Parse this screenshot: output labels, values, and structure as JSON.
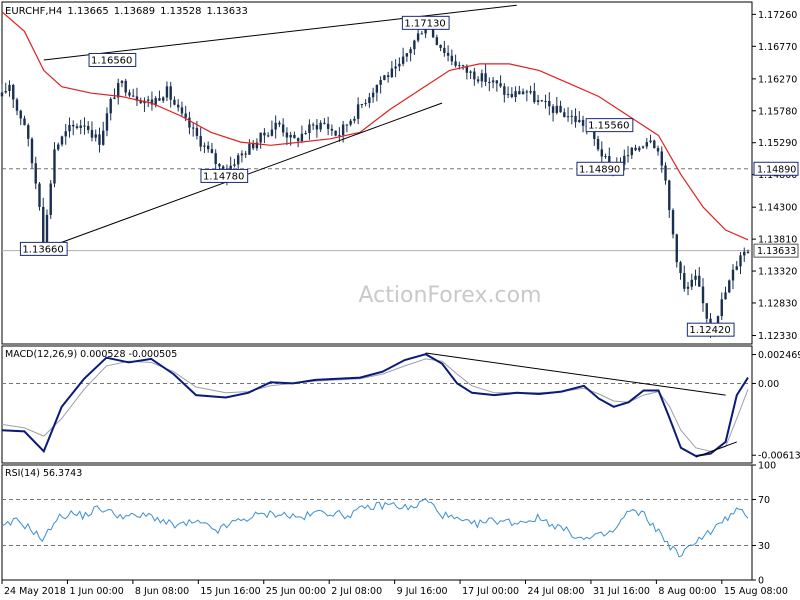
{
  "chart_data": [
    {
      "type": "candlestick",
      "title": "EURCHF,H4",
      "ohlc_readout": [
        "1.13665",
        "1.13689",
        "1.13528",
        "1.13633"
      ],
      "y_ticks": [
        "1.17260",
        "1.16770",
        "1.16270",
        "1.15780",
        "1.15290",
        "1.14800",
        "1.14300",
        "1.13810",
        "1.13320",
        "1.12830",
        "1.12330"
      ],
      "ylim": [
        1.122,
        1.1745
      ],
      "current_price": "1.13633",
      "current_price_value": 1.13633,
      "resistance_label": "1.14890",
      "resistance_value": 1.1489,
      "annotations": [
        {
          "text": "1.16560",
          "value": 1.1656,
          "x_frac": 0.148,
          "side": "left"
        },
        {
          "text": "1.14780",
          "value": 1.1478,
          "x_frac": 0.298,
          "side": "left"
        },
        {
          "text": "1.17130",
          "value": 1.1713,
          "x_frac": 0.568,
          "side": "left"
        },
        {
          "text": "1.15560",
          "value": 1.1556,
          "x_frac": 0.783,
          "side": "right"
        },
        {
          "text": "1.14890",
          "value": 1.1489,
          "x_frac": 0.802,
          "side": "left"
        },
        {
          "text": "1.12420",
          "value": 1.1242,
          "x_frac": 0.95,
          "side": "left"
        },
        {
          "text": "1.13660",
          "value": 1.1366,
          "x_frac": 0.056,
          "side": "left"
        }
      ],
      "close_path": [
        [
          0.0,
          1.16
        ],
        [
          0.01,
          1.162
        ],
        [
          0.02,
          1.158
        ],
        [
          0.03,
          1.156
        ],
        [
          0.04,
          1.15
        ],
        [
          0.05,
          1.144
        ],
        [
          0.056,
          1.137
        ],
        [
          0.07,
          1.152
        ],
        [
          0.09,
          1.155
        ],
        [
          0.11,
          1.156
        ],
        [
          0.13,
          1.153
        ],
        [
          0.148,
          1.16
        ],
        [
          0.16,
          1.162
        ],
        [
          0.18,
          1.16
        ],
        [
          0.2,
          1.159
        ],
        [
          0.22,
          1.161
        ],
        [
          0.24,
          1.157
        ],
        [
          0.26,
          1.154
        ],
        [
          0.28,
          1.151
        ],
        [
          0.298,
          1.148
        ],
        [
          0.31,
          1.15
        ],
        [
          0.33,
          1.152
        ],
        [
          0.35,
          1.154
        ],
        [
          0.37,
          1.156
        ],
        [
          0.39,
          1.153
        ],
        [
          0.41,
          1.155
        ],
        [
          0.43,
          1.156
        ],
        [
          0.45,
          1.154
        ],
        [
          0.47,
          1.157
        ],
        [
          0.49,
          1.16
        ],
        [
          0.51,
          1.163
        ],
        [
          0.53,
          1.164
        ],
        [
          0.55,
          1.168
        ],
        [
          0.568,
          1.1713
        ],
        [
          0.58,
          1.169
        ],
        [
          0.6,
          1.166
        ],
        [
          0.62,
          1.164
        ],
        [
          0.64,
          1.163
        ],
        [
          0.66,
          1.162
        ],
        [
          0.68,
          1.16
        ],
        [
          0.7,
          1.161
        ],
        [
          0.72,
          1.159
        ],
        [
          0.74,
          1.158
        ],
        [
          0.76,
          1.157
        ],
        [
          0.783,
          1.1556
        ],
        [
          0.8,
          1.152
        ],
        [
          0.815,
          1.1489
        ],
        [
          0.83,
          1.15
        ],
        [
          0.85,
          1.152
        ],
        [
          0.87,
          1.154
        ],
        [
          0.885,
          1.15
        ],
        [
          0.895,
          1.142
        ],
        [
          0.905,
          1.135
        ],
        [
          0.915,
          1.13
        ],
        [
          0.93,
          1.132
        ],
        [
          0.94,
          1.128
        ],
        [
          0.95,
          1.1245
        ],
        [
          0.96,
          1.127
        ],
        [
          0.97,
          1.13
        ],
        [
          0.98,
          1.133
        ],
        [
          0.99,
          1.136
        ],
        [
          1.0,
          1.1363
        ]
      ],
      "ma_path": [
        [
          0.0,
          1.173
        ],
        [
          0.03,
          1.17
        ],
        [
          0.056,
          1.164
        ],
        [
          0.08,
          1.1615
        ],
        [
          0.12,
          1.1605
        ],
        [
          0.16,
          1.16
        ],
        [
          0.2,
          1.159
        ],
        [
          0.24,
          1.157
        ],
        [
          0.28,
          1.1545
        ],
        [
          0.32,
          1.153
        ],
        [
          0.36,
          1.1525
        ],
        [
          0.4,
          1.153
        ],
        [
          0.44,
          1.1535
        ],
        [
          0.48,
          1.1545
        ],
        [
          0.52,
          1.158
        ],
        [
          0.56,
          1.161
        ],
        [
          0.6,
          1.164
        ],
        [
          0.64,
          1.165
        ],
        [
          0.68,
          1.165
        ],
        [
          0.72,
          1.164
        ],
        [
          0.76,
          1.162
        ],
        [
          0.8,
          1.16
        ],
        [
          0.84,
          1.157
        ],
        [
          0.88,
          1.154
        ],
        [
          0.91,
          1.148
        ],
        [
          0.94,
          1.143
        ],
        [
          0.97,
          1.1395
        ],
        [
          1.0,
          1.138
        ]
      ],
      "trendlines": [
        {
          "from": [
            0.056,
            1.1656
          ],
          "to": [
            0.69,
            1.174
          ]
        },
        {
          "from": [
            0.056,
            1.1366
          ],
          "to": [
            0.59,
            1.159
          ]
        }
      ]
    },
    {
      "type": "line",
      "title": "MACD(12,26,9) 0.000528 -0.000505",
      "y_ticks": [
        "0.002469",
        "0.00",
        "-0.006136"
      ],
      "ylim": [
        -0.0068,
        0.0032
      ],
      "zero_line": 0,
      "macd_path": [
        [
          0.0,
          -0.004
        ],
        [
          0.03,
          -0.0041
        ],
        [
          0.056,
          -0.0058
        ],
        [
          0.08,
          -0.002
        ],
        [
          0.11,
          0.0004
        ],
        [
          0.14,
          0.0022
        ],
        [
          0.17,
          0.0018
        ],
        [
          0.2,
          0.0021
        ],
        [
          0.23,
          0.0008
        ],
        [
          0.26,
          -0.001
        ],
        [
          0.3,
          -0.0012
        ],
        [
          0.33,
          -0.0008
        ],
        [
          0.36,
          0.0001
        ],
        [
          0.39,
          0.0
        ],
        [
          0.42,
          0.0003
        ],
        [
          0.45,
          0.0004
        ],
        [
          0.48,
          0.0005
        ],
        [
          0.51,
          0.001
        ],
        [
          0.54,
          0.002
        ],
        [
          0.568,
          0.0025
        ],
        [
          0.59,
          0.0017
        ],
        [
          0.61,
          0.0
        ],
        [
          0.63,
          -0.0008
        ],
        [
          0.66,
          -0.001
        ],
        [
          0.69,
          -0.0008
        ],
        [
          0.72,
          -0.0009
        ],
        [
          0.75,
          -0.0007
        ],
        [
          0.78,
          -0.0002
        ],
        [
          0.8,
          -0.0013
        ],
        [
          0.82,
          -0.002
        ],
        [
          0.84,
          -0.0016
        ],
        [
          0.86,
          -0.0006
        ],
        [
          0.88,
          -0.0006
        ],
        [
          0.895,
          -0.003
        ],
        [
          0.91,
          -0.0055
        ],
        [
          0.93,
          -0.0062
        ],
        [
          0.95,
          -0.006
        ],
        [
          0.97,
          -0.005
        ],
        [
          0.985,
          -0.001
        ],
        [
          1.0,
          0.0005
        ]
      ],
      "signal_path": [
        [
          0.0,
          -0.0035
        ],
        [
          0.03,
          -0.0038
        ],
        [
          0.056,
          -0.0045
        ],
        [
          0.08,
          -0.003
        ],
        [
          0.11,
          -0.0005
        ],
        [
          0.14,
          0.0015
        ],
        [
          0.17,
          0.0019
        ],
        [
          0.2,
          0.0018
        ],
        [
          0.23,
          0.001
        ],
        [
          0.26,
          -0.0003
        ],
        [
          0.3,
          -0.0008
        ],
        [
          0.33,
          -0.0007
        ],
        [
          0.36,
          -0.0002
        ],
        [
          0.39,
          0.0
        ],
        [
          0.42,
          0.0002
        ],
        [
          0.45,
          0.0003
        ],
        [
          0.48,
          0.0004
        ],
        [
          0.51,
          0.0008
        ],
        [
          0.54,
          0.0015
        ],
        [
          0.568,
          0.0021
        ],
        [
          0.59,
          0.0019
        ],
        [
          0.61,
          0.0008
        ],
        [
          0.63,
          -0.0002
        ],
        [
          0.66,
          -0.0008
        ],
        [
          0.69,
          -0.0008
        ],
        [
          0.72,
          -0.0008
        ],
        [
          0.75,
          -0.0007
        ],
        [
          0.78,
          -0.0004
        ],
        [
          0.8,
          -0.0009
        ],
        [
          0.82,
          -0.0015
        ],
        [
          0.84,
          -0.0016
        ],
        [
          0.86,
          -0.001
        ],
        [
          0.88,
          -0.0007
        ],
        [
          0.895,
          -0.002
        ],
        [
          0.91,
          -0.004
        ],
        [
          0.93,
          -0.0055
        ],
        [
          0.95,
          -0.0058
        ],
        [
          0.97,
          -0.0054
        ],
        [
          0.985,
          -0.003
        ],
        [
          1.0,
          -0.0005
        ]
      ],
      "trendlines": [
        {
          "from": [
            0.568,
            0.0026
          ],
          "to": [
            0.97,
            -0.001
          ]
        },
        {
          "from": [
            0.93,
            -0.0063
          ],
          "to": [
            0.985,
            -0.005
          ]
        }
      ]
    },
    {
      "type": "line",
      "title": "RSI(14) 56.3743",
      "y_ticks": [
        "100",
        "70",
        "30",
        "0"
      ],
      "ylim": [
        0,
        100
      ],
      "levels": [
        70,
        30
      ],
      "rsi_path": [
        [
          0.0,
          45
        ],
        [
          0.02,
          52
        ],
        [
          0.04,
          44
        ],
        [
          0.056,
          34
        ],
        [
          0.07,
          52
        ],
        [
          0.09,
          58
        ],
        [
          0.11,
          56
        ],
        [
          0.13,
          63
        ],
        [
          0.148,
          58
        ],
        [
          0.17,
          55
        ],
        [
          0.2,
          56
        ],
        [
          0.23,
          47
        ],
        [
          0.26,
          50
        ],
        [
          0.29,
          43
        ],
        [
          0.31,
          50
        ],
        [
          0.34,
          56
        ],
        [
          0.37,
          58
        ],
        [
          0.4,
          54
        ],
        [
          0.43,
          60
        ],
        [
          0.46,
          56
        ],
        [
          0.49,
          63
        ],
        [
          0.52,
          66
        ],
        [
          0.55,
          62
        ],
        [
          0.568,
          70
        ],
        [
          0.59,
          57
        ],
        [
          0.61,
          52
        ],
        [
          0.63,
          48
        ],
        [
          0.66,
          52
        ],
        [
          0.69,
          50
        ],
        [
          0.72,
          54
        ],
        [
          0.75,
          45
        ],
        [
          0.78,
          35
        ],
        [
          0.8,
          38
        ],
        [
          0.82,
          42
        ],
        [
          0.84,
          60
        ],
        [
          0.86,
          57
        ],
        [
          0.88,
          42
        ],
        [
          0.895,
          30
        ],
        [
          0.91,
          20
        ],
        [
          0.93,
          35
        ],
        [
          0.95,
          42
        ],
        [
          0.97,
          53
        ],
        [
          0.985,
          60
        ],
        [
          1.0,
          56
        ]
      ]
    }
  ],
  "x_axis": {
    "labels": [
      "24 May 2018",
      "1 Jun 00:00",
      "8 Jun 08:00",
      "15 Jun 16:00",
      "25 Jun 00:00",
      "2 Jul 08:00",
      "9 Jul 16:00",
      "17 Jul 00:00",
      "24 Jul 08:00",
      "31 Jul 16:00",
      "8 Aug 00:00",
      "15 Aug 08:00"
    ]
  },
  "watermark": "ActionForex.com",
  "colors": {
    "bg": "#ffffff",
    "candle": "#1a3050",
    "ma": "#e02020",
    "macd": "#0a1a7a",
    "signal": "#9aa0aa",
    "rsi": "#3a8fd0",
    "trendline": "#000000",
    "label_border": "#1a2a7a",
    "watermark": "#c9c9c9",
    "axis": "#000000",
    "dashed": "#777777"
  }
}
